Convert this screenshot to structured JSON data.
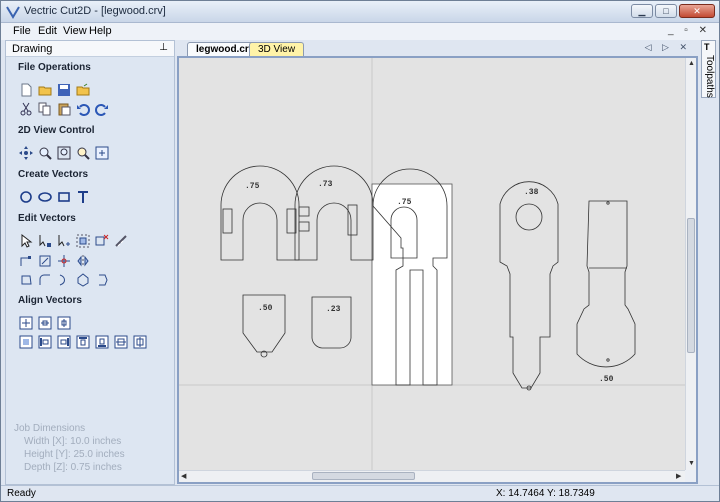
{
  "window": {
    "title": "Vectric Cut2D - [legwood.crv]"
  },
  "menu": [
    "File",
    "Edit",
    "View",
    "Help"
  ],
  "panel": {
    "header": "Drawing",
    "sections": {
      "file_operations": "File Operations",
      "view_control": "2D View Control",
      "create_vectors": "Create Vectors",
      "edit_vectors": "Edit Vectors",
      "align_vectors": "Align Vectors"
    },
    "job": {
      "title": "Job Dimensions",
      "width": "Width  [X]: 10.0 inches",
      "height": "Height [Y]: 25.0 inches",
      "depth": "Depth  [Z]: 0.75 inches"
    }
  },
  "tabs": {
    "doc": "legwood.crv",
    "view3d": "3D View"
  },
  "side_tab": "Toolpaths",
  "canvas": {
    "labels": [
      ".75",
      ".73",
      ".75",
      ".38",
      ".50",
      ".23",
      ".50"
    ]
  },
  "status": {
    "ready": "Ready",
    "coords": "X: 14.7464 Y: 18.7349"
  }
}
